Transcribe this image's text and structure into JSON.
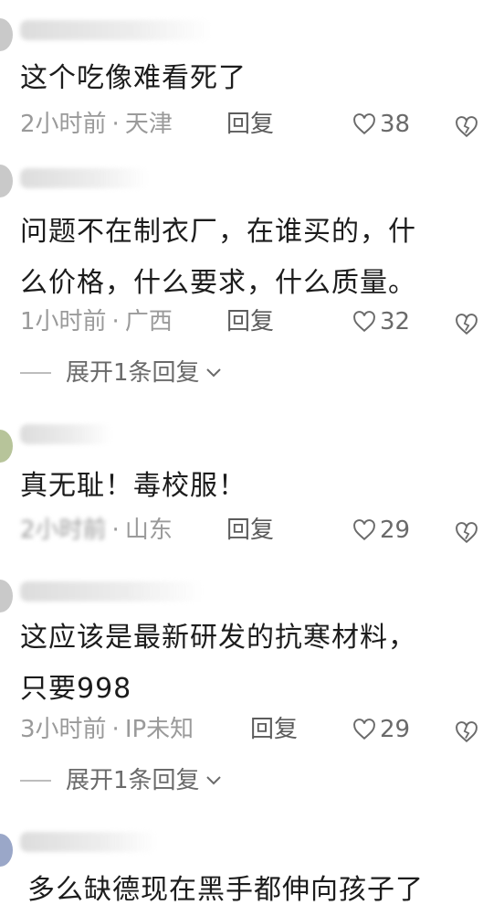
{
  "comments": [
    {
      "text": "这个吃像难看死了",
      "time": "2小时前",
      "location": "天津",
      "reply_label": "回复",
      "likes": "38"
    },
    {
      "text": "问题不在制衣厂，在谁买的，什\n么价格，什么要求，什么质量。",
      "time": "1小时前",
      "location": "广西",
      "reply_label": "回复",
      "likes": "32",
      "expand_label": "展开1条回复"
    },
    {
      "text": "真无耻！毒校服！",
      "time": "2小时前",
      "location": "山东",
      "reply_label": "回复",
      "likes": "29"
    },
    {
      "text": "这应该是最新研发的抗寒材料，\n只要998",
      "time": "3小时前",
      "location": "IP未知",
      "reply_label": "回复",
      "likes": "29",
      "expand_label": "展开1条回复"
    },
    {
      "text": "多么缺德现在黑手都伸向孩子了"
    }
  ],
  "separator": "·",
  "icons": {
    "like": "heart-outline-icon",
    "dislike": "broken-heart-icon",
    "expand": "chevron-down-icon"
  },
  "colors": {
    "meta_text": "#9a9a9a",
    "reply_text": "#5c5c5c",
    "body_text": "#1c1c1c"
  }
}
